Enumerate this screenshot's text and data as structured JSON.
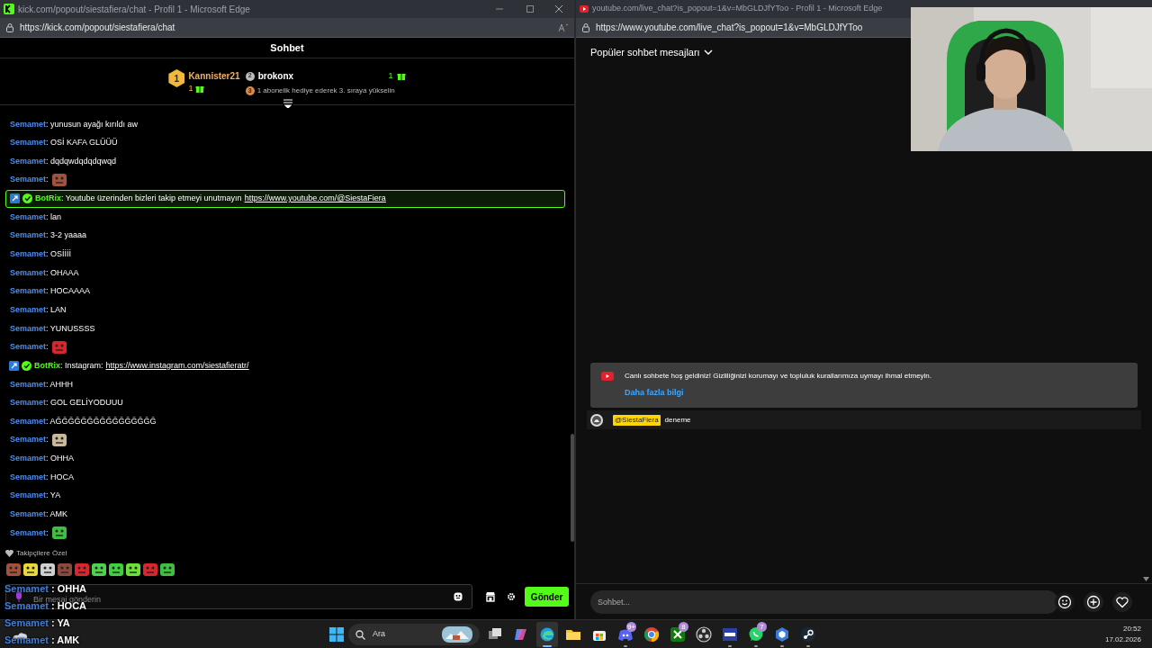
{
  "kick_window": {
    "title": "kick.com/popout/siestafiera/chat - Profil 1 - Microsoft Edge",
    "address": "https://kick.com/popout/siestafiera/chat",
    "header": "Sohbet",
    "leaderboard": [
      {
        "rank": "1",
        "name": "Kannister21",
        "count": "1"
      },
      {
        "rank": "2",
        "name": "brokonx",
        "count": "1"
      }
    ],
    "leaderboard_hint": {
      "rank": "3",
      "text": "1 abonelik hediye ederek 3. sıraya yükselin"
    },
    "messages": [
      {
        "kind": "text",
        "user": "Semamet",
        "text": ": yunusun ayağı kırıldı aw"
      },
      {
        "kind": "text",
        "user": "Semamet",
        "text": ": OSİ KAFA GLÜÜÜ"
      },
      {
        "kind": "text",
        "user": "Semamet",
        "text": ": dqdqwdqdqdqwqd"
      },
      {
        "kind": "emote",
        "user": "Semamet",
        "text": ":",
        "color": "#a0523c"
      },
      {
        "kind": "bot",
        "user": "BotRix",
        "text": ": Youtube üzerinden bizleri takip etmeyi unutmayın",
        "link": "https://www.youtube.com/@SiestaFiera",
        "highlighted": true
      },
      {
        "kind": "text",
        "user": "Semamet",
        "text": ": lan"
      },
      {
        "kind": "text",
        "user": "Semamet",
        "text": ": 3-2 yaaaa"
      },
      {
        "kind": "text",
        "user": "Semamet",
        "text": ": OSİİİİ"
      },
      {
        "kind": "text",
        "user": "Semamet",
        "text": ": OHAAA"
      },
      {
        "kind": "text",
        "user": "Semamet",
        "text": ": HOCAAAA"
      },
      {
        "kind": "text",
        "user": "Semamet",
        "text": ": LAN"
      },
      {
        "kind": "text",
        "user": "Semamet",
        "text": ": YUNUSSSS"
      },
      {
        "kind": "emote",
        "user": "Semamet",
        "text": ":",
        "color": "#d8262e"
      },
      {
        "kind": "bot",
        "user": "BotRix",
        "text": ": Instagram:",
        "link": "https://www.instagram.com/siestafieratr/",
        "highlighted": false
      },
      {
        "kind": "text",
        "user": "Semamet",
        "text": ": AHHH"
      },
      {
        "kind": "text",
        "user": "Semamet",
        "text": ": GOL GELİYODUUU"
      },
      {
        "kind": "text",
        "user": "Semamet",
        "text": ": AĞĞĞĞĞĞĞĞĞĞĞĞĞĞĞĞ"
      },
      {
        "kind": "emote",
        "user": "Semamet",
        "text": ":",
        "color": "#c9b99a"
      },
      {
        "kind": "text",
        "user": "Semamet",
        "text": ": OHHA"
      },
      {
        "kind": "text",
        "user": "Semamet",
        "text": ": HOCA"
      },
      {
        "kind": "text",
        "user": "Semamet",
        "text": ": YA"
      },
      {
        "kind": "text",
        "user": "Semamet",
        "text": ": AMK"
      },
      {
        "kind": "emote",
        "user": "Semamet",
        "text": ":",
        "color": "#3fbf3f"
      }
    ],
    "emote_section": "Takipçilere Özel",
    "emotes": [
      {
        "color": "#a0523c"
      },
      {
        "color": "#e8d83a"
      },
      {
        "color": "#d0d0d0"
      },
      {
        "color": "#8a4a3c"
      },
      {
        "color": "#d8262e"
      },
      {
        "color": "#4fd04f"
      },
      {
        "color": "#3fcf3f"
      },
      {
        "color": "#6ce03a"
      },
      {
        "color": "#d8262e"
      },
      {
        "color": "#3fbf3f"
      }
    ],
    "input": {
      "placeholder": "Bir mesaj gönderin"
    },
    "send_button": "Gönder"
  },
  "youtube_window": {
    "title": "youtube.com/live_chat?is_popout=1&v=MbGLDJfYToo - Profil 1 - Microsoft Edge",
    "address": "https://www.youtube.com/live_chat?is_popout=1&v=MbGLDJfYToo",
    "header": "Popüler sohbet mesajları",
    "welcome": {
      "text": "Canlı sohbete hoş geldiniz! Gizliliğinizi korumayı ve topluluk kurallarımıza uymayı ihmal etmeyin.",
      "link": "Daha fazla bilgi"
    },
    "messages": [
      {
        "author": "@SiestaFiera",
        "text": "deneme"
      }
    ],
    "input": {
      "placeholder": "Sohbet..."
    }
  },
  "stream_overlay": [
    {
      "user": "Semamet",
      "text": ": OHHA"
    },
    {
      "user": "Semamet",
      "text": ": HOCA"
    },
    {
      "user": "Semamet",
      "text": ": YA"
    },
    {
      "user": "Semamet",
      "text": ": AMK"
    }
  ],
  "taskbar": {
    "search": "Ara",
    "apps": [
      {
        "kind": "taskview",
        "running": false,
        "active": false
      },
      {
        "kind": "copilot",
        "running": false,
        "active": false
      },
      {
        "kind": "edge",
        "running": true,
        "active": true
      },
      {
        "kind": "folder",
        "running": false,
        "active": false
      },
      {
        "kind": "store",
        "running": false,
        "active": false
      },
      {
        "kind": "discord",
        "running": true,
        "active": false,
        "badge": "9+"
      },
      {
        "kind": "chrome",
        "running": false,
        "active": false
      },
      {
        "kind": "xbox",
        "running": false,
        "active": false,
        "badge": "8"
      },
      {
        "kind": "obs",
        "running": false,
        "active": false
      },
      {
        "kind": "mkd",
        "running": true,
        "active": false
      },
      {
        "kind": "whatsapp",
        "running": true,
        "active": false,
        "badge": "7"
      },
      {
        "kind": "cube",
        "running": true,
        "active": false
      },
      {
        "kind": "steam",
        "running": true,
        "active": false
      }
    ],
    "time": "20:52",
    "date": "17.02.2026"
  }
}
